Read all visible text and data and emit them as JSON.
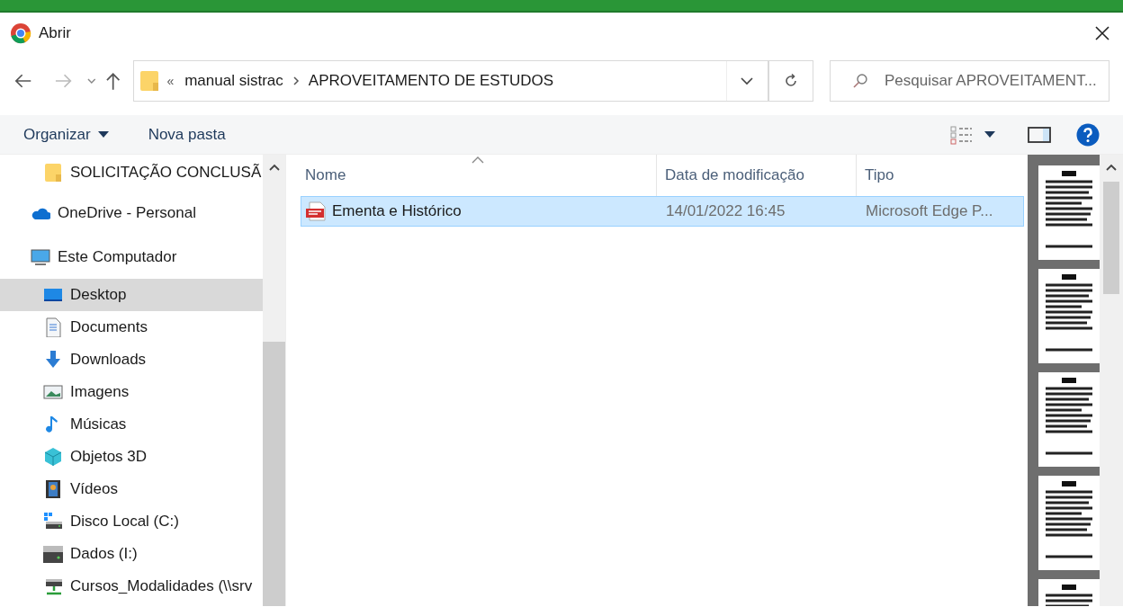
{
  "window": {
    "title": "Abrir"
  },
  "address": {
    "overflow": "«",
    "path": [
      "manual sistrac",
      "APROVEITAMENTO DE ESTUDOS"
    ]
  },
  "search": {
    "placeholder": "Pesquisar APROVEITAMENT..."
  },
  "toolbar": {
    "organize": "Organizar",
    "new_folder": "Nova pasta"
  },
  "sidebar": {
    "items": [
      {
        "label": "SOLICITAÇÃO CONCLUSÃ",
        "kind": "folder",
        "selected": false
      },
      {
        "label": "OneDrive - Personal",
        "kind": "cloud",
        "selected": false
      },
      {
        "label": "Este Computador",
        "kind": "computer",
        "selected": false,
        "children": [
          {
            "label": "Desktop",
            "kind": "desktop",
            "selected": true
          },
          {
            "label": "Documents",
            "kind": "documents",
            "selected": false
          },
          {
            "label": "Downloads",
            "kind": "downloads",
            "selected": false
          },
          {
            "label": "Imagens",
            "kind": "images",
            "selected": false
          },
          {
            "label": "Músicas",
            "kind": "music",
            "selected": false
          },
          {
            "label": "Objetos 3D",
            "kind": "objects",
            "selected": false
          },
          {
            "label": "Vídeos",
            "kind": "videos",
            "selected": false
          },
          {
            "label": "Disco Local (C:)",
            "kind": "system_drive",
            "selected": false
          },
          {
            "label": "Dados (I:)",
            "kind": "drive",
            "selected": false
          },
          {
            "label": "Cursos_Modalidades (\\\\srv",
            "kind": "network",
            "selected": false
          }
        ]
      }
    ]
  },
  "table": {
    "columns": [
      "Nome",
      "Data de modificação",
      "Tipo"
    ],
    "rows": [
      {
        "name": "Ementa e Histórico",
        "modified": "14/01/2022 16:45",
        "type": "Microsoft Edge P...",
        "selected": true
      }
    ]
  }
}
